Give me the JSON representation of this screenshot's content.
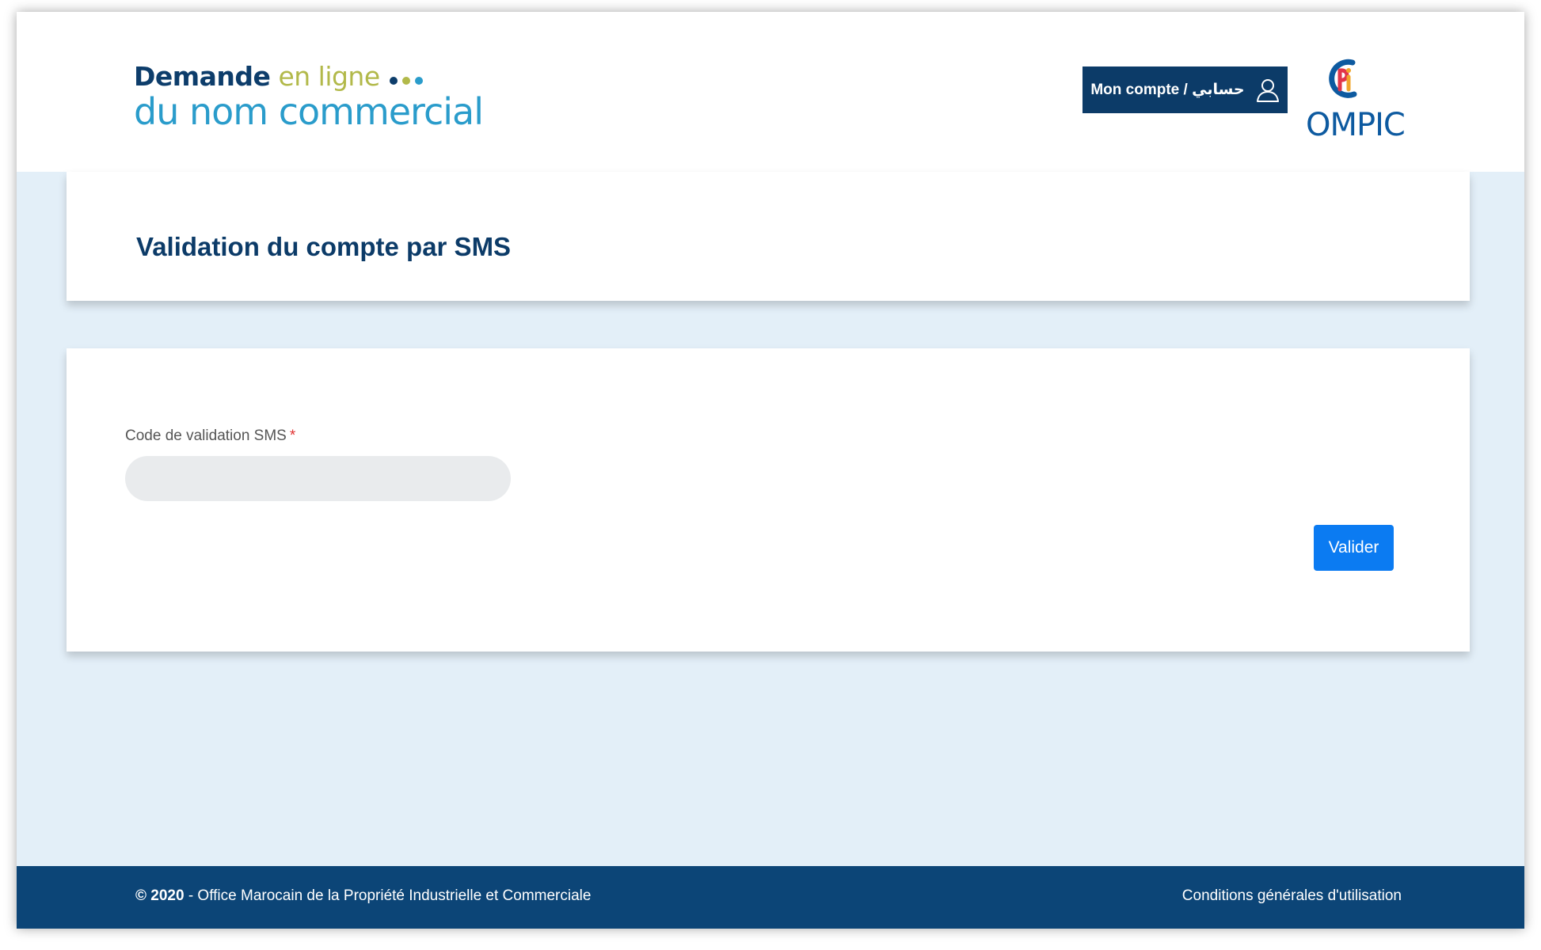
{
  "header": {
    "logo": {
      "line1_main": "Demande",
      "line1_accent": "en ligne",
      "line2": "du nom commercial",
      "dot_colors": [
        "#0d3d6b",
        "#b2b94a",
        "#2a9ccb"
      ]
    },
    "account_button_label": "Mon compte / حسابي",
    "ompic_logo_text": "OMPIC"
  },
  "page": {
    "title": "Validation du compte par SMS"
  },
  "form": {
    "field_label": "Code de validation SMS",
    "required_mark": "*",
    "field_value": "",
    "field_placeholder": "",
    "submit_label": "Valider"
  },
  "footer": {
    "copyright_year": "© 2020",
    "copyright_text": " - Office Marocain de la Propriété Industrielle et Commerciale",
    "terms_link": "Conditions générales d'utilisation"
  },
  "colors": {
    "primary_navy": "#0c3b68",
    "accent_blue": "#0b7bf2",
    "background": "#e3eff8",
    "required_red": "#e03030"
  }
}
